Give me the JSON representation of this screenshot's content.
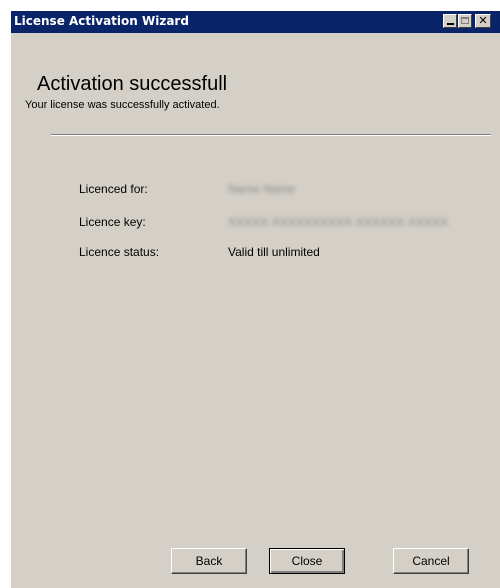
{
  "window": {
    "title": "License Activation Wizard",
    "controls": {
      "minimize": "minimize-icon",
      "maximize": "maximize-icon",
      "close": "✕"
    }
  },
  "header": {
    "title": "Activation successfull",
    "subtitle": "Your license was successfully activated."
  },
  "details": [
    {
      "label": "Licenced for:",
      "value": "Name Name",
      "blurred": true
    },
    {
      "label": "Licence key:",
      "value": "XXXXX-XXXXXXXXXX-XXXXXX-XXXXX",
      "blurred": true
    },
    {
      "label": "Licence status:",
      "value": "Valid till unlimited",
      "blurred": false
    }
  ],
  "buttons": {
    "back": "Back",
    "close": "Close",
    "cancel": "Cancel"
  },
  "colors": {
    "titlebar": "#0a246a",
    "window_bg": "#d4d0c8"
  }
}
